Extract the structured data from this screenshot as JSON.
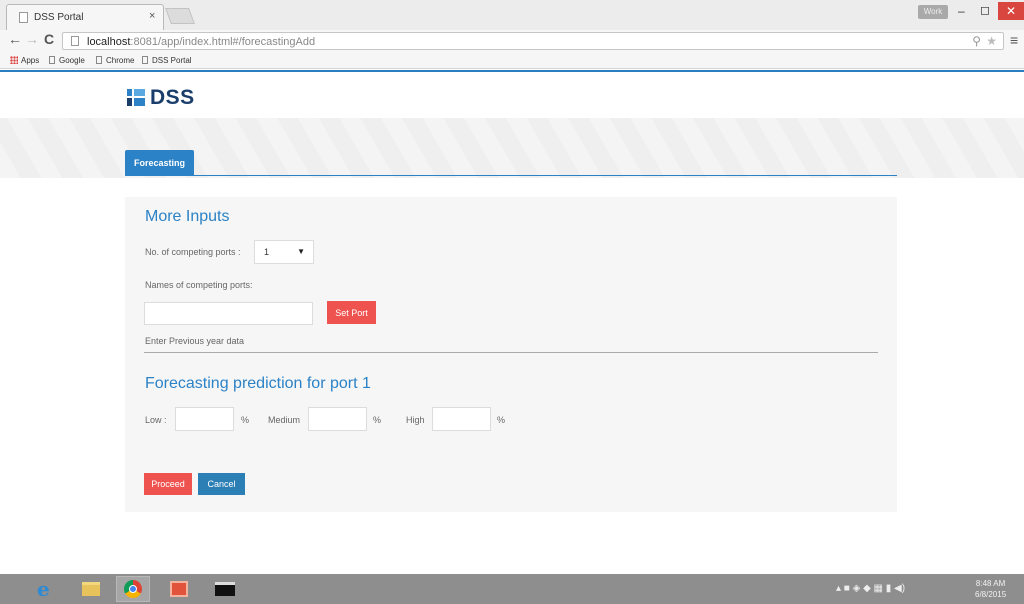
{
  "browser": {
    "tab_title": "DSS Portal",
    "tab_close": "×",
    "user_badge": "Work",
    "url_host": "localhost",
    "url_path": ":8081/app/index.html#/forecastingAdd",
    "bookmarks": [
      "Apps",
      "Google",
      "Chrome",
      "DSS Portal"
    ],
    "icons": {
      "back": "back-arrow-icon",
      "forward": "forward-arrow-icon",
      "reload": "reload-icon",
      "zoom": "zoom-icon",
      "star": "bookmark-star-icon",
      "menu": "hamburger-menu-icon"
    }
  },
  "app": {
    "logo_text": "DSS",
    "tab_label": "Forecasting"
  },
  "more_inputs": {
    "title": "More Inputs",
    "competing_ports_label": "No. of competing ports :",
    "competing_ports_value": "1",
    "names_label": "Names of competing ports:",
    "name_input_value": "",
    "set_port_label": "Set Port",
    "previous_year_label": "Enter Previous year data"
  },
  "prediction": {
    "title": "Forecasting prediction for port 1",
    "low_label": "Low :",
    "medium_label": "Medium",
    "high_label": "High",
    "percent_sign": "%",
    "low_value": "",
    "medium_value": "",
    "high_value": ""
  },
  "actions": {
    "proceed_label": "Proceed",
    "cancel_label": "Cancel"
  },
  "taskbar": {
    "apps": [
      "internet-explorer-icon",
      "file-explorer-icon",
      "chrome-icon",
      "media-app-icon",
      "command-prompt-icon"
    ],
    "time": "8:48 AM",
    "date": "6/8/2015"
  },
  "colors": {
    "accent": "#2b82c6",
    "danger": "#ef5350",
    "logo": "#1a3e6b"
  }
}
